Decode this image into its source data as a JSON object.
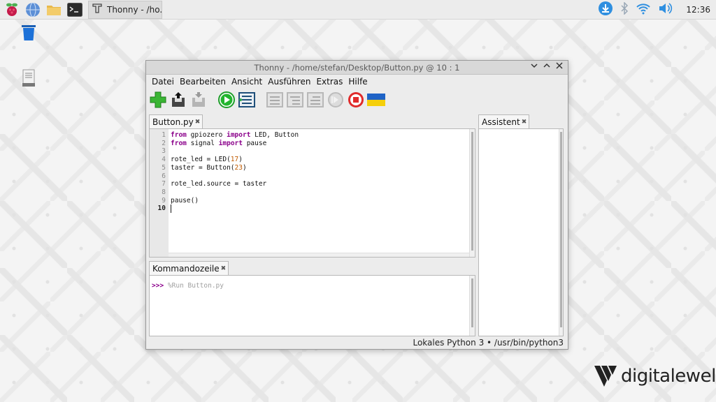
{
  "taskbar": {
    "task_label": "Thonny - /ho...",
    "clock": "12:36"
  },
  "window": {
    "title": "Thonny - /home/stefan/Desktop/Button.py @ 10 : 1"
  },
  "menu": [
    "Datei",
    "Bearbeiten",
    "Ansicht",
    "Ausführen",
    "Extras",
    "Hilfe"
  ],
  "editor": {
    "tab_label": "Button.py",
    "line_numbers": [
      "1",
      "2",
      "3",
      "4",
      "5",
      "6",
      "7",
      "8",
      "9",
      "10"
    ]
  },
  "shell": {
    "tab_label": "Kommandozeile",
    "prompt": ">>>",
    "command": "%Run Button.py"
  },
  "assistant": {
    "tab_label": "Assistent"
  },
  "status": {
    "interpreter": "Lokales Python 3 • /usr/bin/python3"
  },
  "brand": {
    "text": "digitalewelt"
  }
}
